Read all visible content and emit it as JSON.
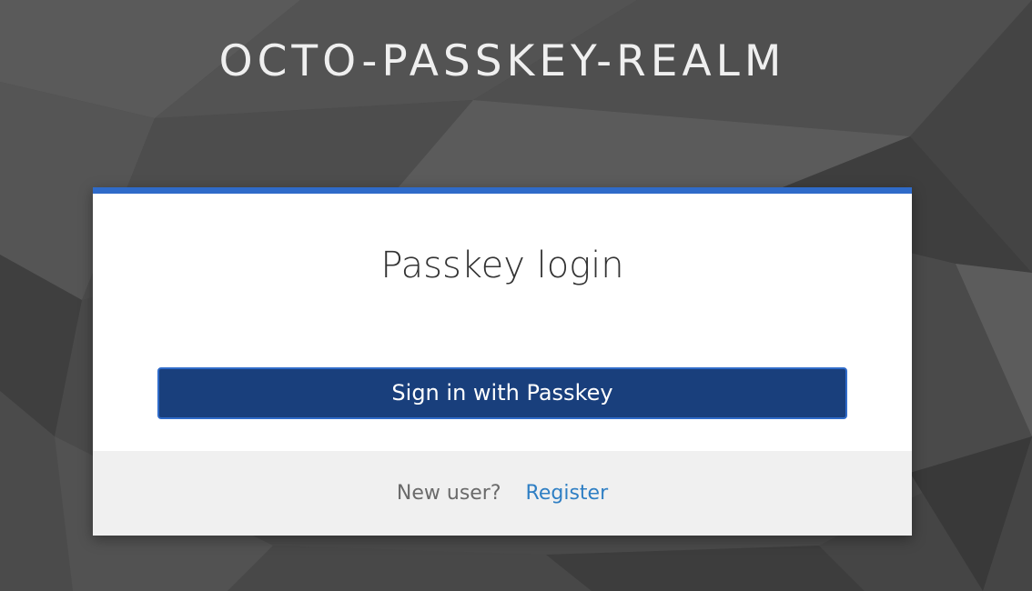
{
  "realm": {
    "title": "OCTO-PASSKEY-REALM"
  },
  "login": {
    "heading": "Passkey login",
    "passkey_button_label": "Sign in with Passkey"
  },
  "footer": {
    "new_user_text": "New user?",
    "register_link": "Register"
  },
  "colors": {
    "background": "#4a4a4a",
    "accent": "#2f6bc9",
    "button": "#193f7c",
    "link": "#2f7fc4",
    "footer_bg": "#f0f0f0"
  }
}
